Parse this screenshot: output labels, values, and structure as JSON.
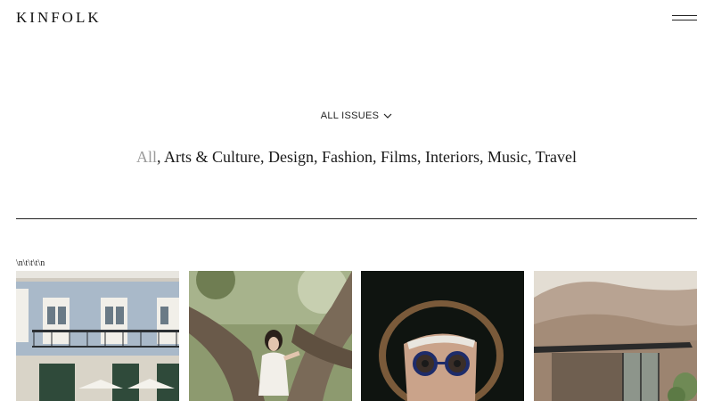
{
  "header": {
    "logo": "KINFOLK",
    "menu_icon": "hamburger-menu-icon"
  },
  "issues_filter": {
    "label": "ALL ISSUES",
    "icon": "chevron-down-icon"
  },
  "categories": {
    "items": [
      "All",
      "Arts & Culture",
      "Design",
      "Fashion",
      "Films",
      "Interiors",
      "Music",
      "Travel"
    ],
    "active": "All",
    "separator": ", "
  },
  "stray_text": "\\n\\t\\t\\t\\n",
  "grid": {
    "cards": [
      {
        "image": "blue-tiled-building-facade-photo"
      },
      {
        "image": "girl-in-tree-photo"
      },
      {
        "image": "man-with-round-glasses-photo"
      },
      {
        "image": "desert-hills-shelter-photo"
      }
    ]
  },
  "colors": {
    "text": "#111111",
    "active_category": "#9a9a9a",
    "background": "#ffffff"
  }
}
